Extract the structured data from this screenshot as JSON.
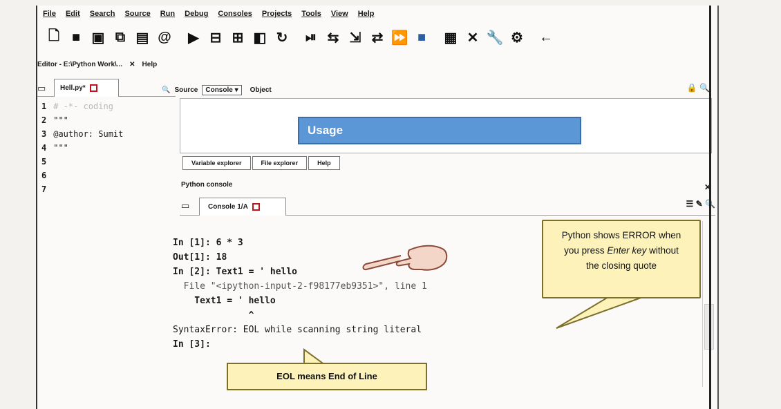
{
  "menu": [
    "File",
    "Edit",
    "Search",
    "Source",
    "Run",
    "Debug",
    "Consoles",
    "Projects",
    "Tools",
    "View",
    "Help"
  ],
  "toolbar_icons": [
    "new-file-icon",
    "open-folder-icon",
    "save-icon",
    "save-all-icon",
    "stack-icon",
    "at-icon",
    "run-icon",
    "run-cell-icon",
    "run-cell-advance-icon",
    "run-selection-icon",
    "re-run-icon",
    "debug-icon",
    "step-icon",
    "step-into-icon",
    "step-return-icon",
    "continue-icon",
    "stop-icon",
    "maximize-pane-icon",
    "fullscreen-icon",
    "wrench-icon",
    "python-path-icon",
    "back-arrow-icon"
  ],
  "editor": {
    "title": "Editor - E:\\Python Work\\...",
    "help_label": "Help",
    "tab_label": "Hell.py*",
    "lines": [
      {
        "n": "1",
        "text": "# -*- coding"
      },
      {
        "n": "2",
        "text": "\"\"\""
      },
      {
        "n": "3",
        "text": "@author: Sumit"
      },
      {
        "n": "4",
        "text": "\"\"\""
      },
      {
        "n": "5",
        "text": ""
      },
      {
        "n": "6",
        "text": ""
      },
      {
        "n": "7",
        "text": ""
      }
    ]
  },
  "help": {
    "source_label": "Source",
    "source_value": "Console",
    "object_label": "Object",
    "usage_label": "Usage",
    "tabs": [
      "Variable explorer",
      "File explorer",
      "Help"
    ]
  },
  "console": {
    "title": "Python console",
    "tab_label": "Console 1/A",
    "lines": [
      "In [1]: 6 * 3",
      "Out[1]: 18",
      "",
      "In [2]: Text1 = ' hello",
      "  File \"<ipython-input-2-f98177eb9351>\", line 1",
      "    Text1 = ' hello",
      "              ^",
      "SyntaxError: EOL while scanning string literal",
      "",
      "",
      "In [3]:"
    ]
  },
  "callouts": {
    "error_line1": "Python shows ERROR when",
    "error_line2_a": "you press ",
    "error_line2_b": "Enter key",
    "error_line2_c": " without",
    "error_line3": "the closing quote",
    "eol": "EOL means End of Line"
  },
  "colors": {
    "accent": "#5b96d6",
    "callout_bg": "#fdf3ba",
    "tab_red": "#c0131b"
  }
}
